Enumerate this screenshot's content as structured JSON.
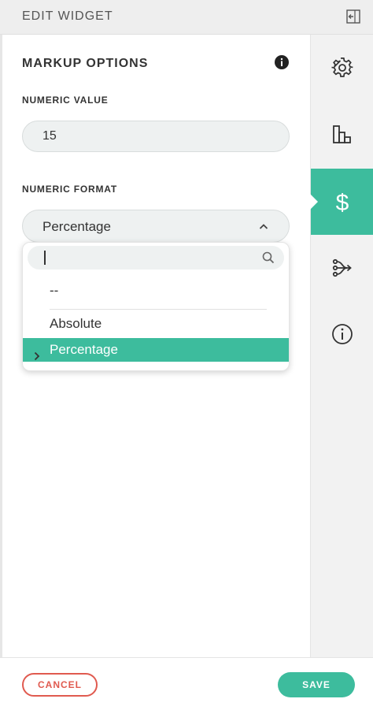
{
  "header": {
    "title": "EDIT WIDGET",
    "collapse_icon": "collapse-panel-icon"
  },
  "main": {
    "section_title": "MARKUP OPTIONS",
    "info_icon": "info-icon",
    "numeric_value": {
      "label": "NUMERIC VALUE",
      "value": "15"
    },
    "numeric_format": {
      "label": "NUMERIC FORMAT",
      "selected": "Percentage",
      "dropdown_open": true,
      "search_value": "",
      "options": [
        "--",
        "Absolute",
        "Percentage"
      ],
      "highlighted_option": "Percentage"
    }
  },
  "sidebar": {
    "items": [
      {
        "icon": "gear-icon",
        "active": false
      },
      {
        "icon": "bar-chart-icon",
        "active": false
      },
      {
        "icon": "dollar-icon",
        "active": true
      },
      {
        "icon": "branch-arrows-icon",
        "active": false
      },
      {
        "icon": "info-circle-icon",
        "active": false
      }
    ]
  },
  "footer": {
    "cancel_label": "CANCEL",
    "save_label": "SAVE"
  },
  "colors": {
    "accent": "#3dbc9d",
    "cancel": "#e05a4f",
    "field_bg": "#eef1f1",
    "header_bg": "#eeeeee"
  }
}
